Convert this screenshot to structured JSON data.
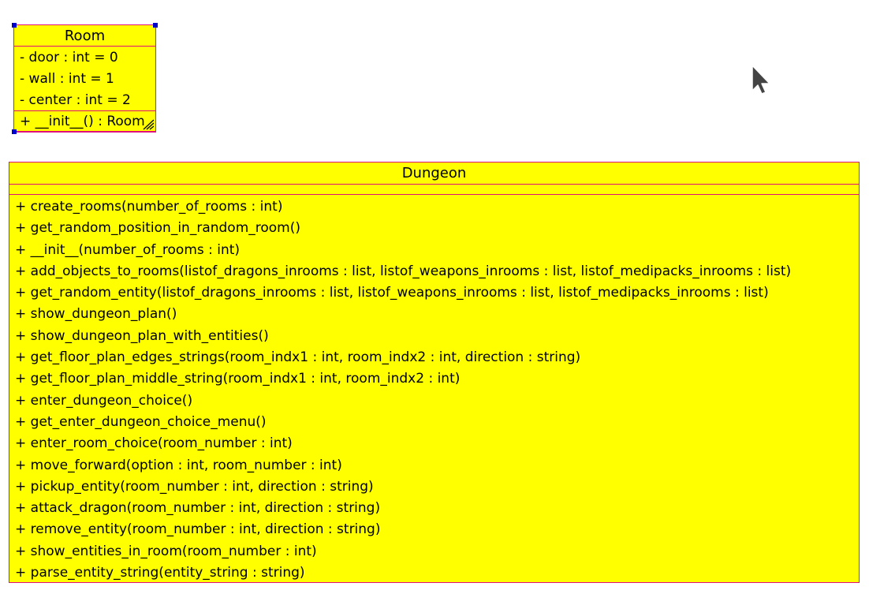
{
  "room": {
    "name": "Room",
    "attributes": [
      "- door : int = 0",
      "- wall : int = 1",
      "- center : int = 2"
    ],
    "operations": [
      "+ __init__() : Room"
    ]
  },
  "dungeon": {
    "name": "Dungeon",
    "attributes": [],
    "operations": [
      "+ create_rooms(number_of_rooms : int)",
      "+ get_random_position_in_random_room()",
      "+ __init__(number_of_rooms : int)",
      "+ add_objects_to_rooms(listof_dragons_inrooms : list, listof_weapons_inrooms : list, listof_medipacks_inrooms : list)",
      "+ get_random_entity(listof_dragons_inrooms : list, listof_weapons_inrooms : list, listof_medipacks_inrooms : list)",
      "+ show_dungeon_plan()",
      "+ show_dungeon_plan_with_entities()",
      "+ get_floor_plan_edges_strings(room_indx1 : int, room_indx2 : int, direction : string)",
      "+ get_floor_plan_middle_string(room_indx1 : int, room_indx2 : int)",
      "+ enter_dungeon_choice()",
      "+ get_enter_dungeon_choice_menu()",
      "+ enter_room_choice(room_number : int)",
      "+ move_forward(option : int, room_number : int)",
      "+ pickup_entity(room_number : int, direction : string)",
      "+ attack_dragon(room_number : int, direction : string)",
      "+ remove_entity(room_number : int, direction : string)",
      "+ show_entities_in_room(room_number : int)",
      "+ parse_entity_string(entity_string : string)"
    ]
  },
  "colors": {
    "class_fill": "#ffff00",
    "class_border": "#e0107a",
    "selection_handle": "#0000cc"
  },
  "icons": {
    "cursor": "mouse-pointer-icon",
    "resize": "resize-grip-icon"
  }
}
